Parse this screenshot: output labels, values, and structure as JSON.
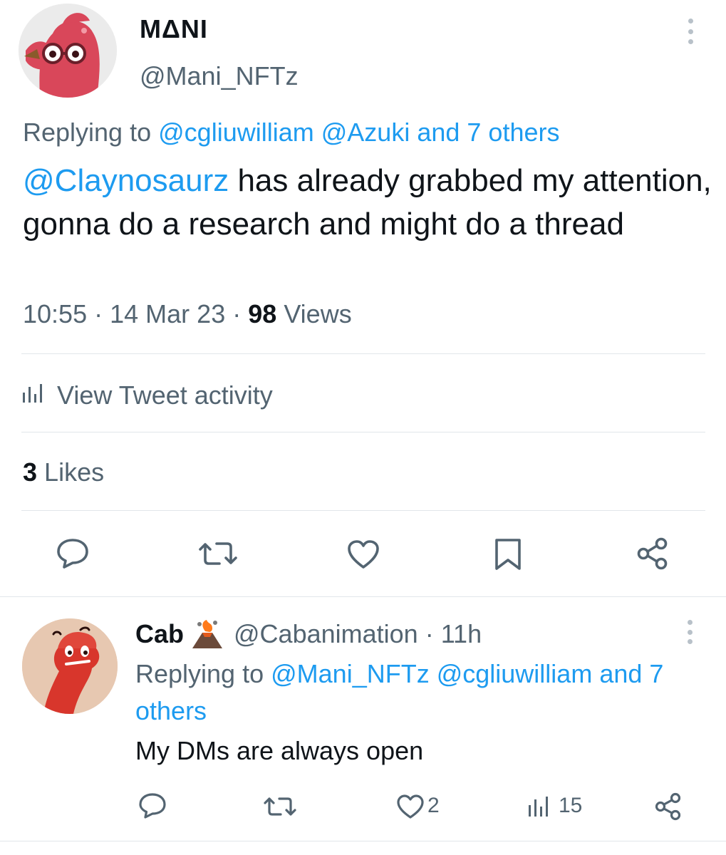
{
  "main_tweet": {
    "author": {
      "display_name": "MΔNI",
      "handle": "@Mani_NFTz"
    },
    "replying_to": {
      "prefix": "Replying to",
      "users": [
        "@cgliuwilliam",
        "@Azuki"
      ],
      "others": "and 7 others"
    },
    "text": {
      "mention": "@Claynosaurz",
      "body": " has already grabbed my attention, gonna do a research and might do a thread"
    },
    "meta": {
      "time": "10:55",
      "date": "14 Mar 23",
      "views_count": "98",
      "views_label": "Views",
      "separator": "·"
    },
    "activity_label": "View Tweet activity",
    "likes": {
      "count": "3",
      "label": "Likes"
    },
    "actions": [
      "reply-icon",
      "retweet-icon",
      "like-icon",
      "bookmark-icon",
      "share-icon"
    ]
  },
  "reply_tweet": {
    "author": {
      "display_name": "Cab",
      "handle": "@Cabanimation",
      "time_ago": "11h",
      "separator": "·"
    },
    "replying_to": {
      "prefix": "Replying to",
      "users": [
        "@Mani_NFTz",
        "@cgliuwilliam"
      ],
      "others": "and 7 others"
    },
    "text": "My DMs are always open",
    "actions": {
      "likes_count": "2",
      "views_count": "15"
    }
  },
  "colors": {
    "text": "#0f1419",
    "muted": "#536471",
    "link": "#1d9bf0",
    "divider": "#e1e6ea"
  }
}
